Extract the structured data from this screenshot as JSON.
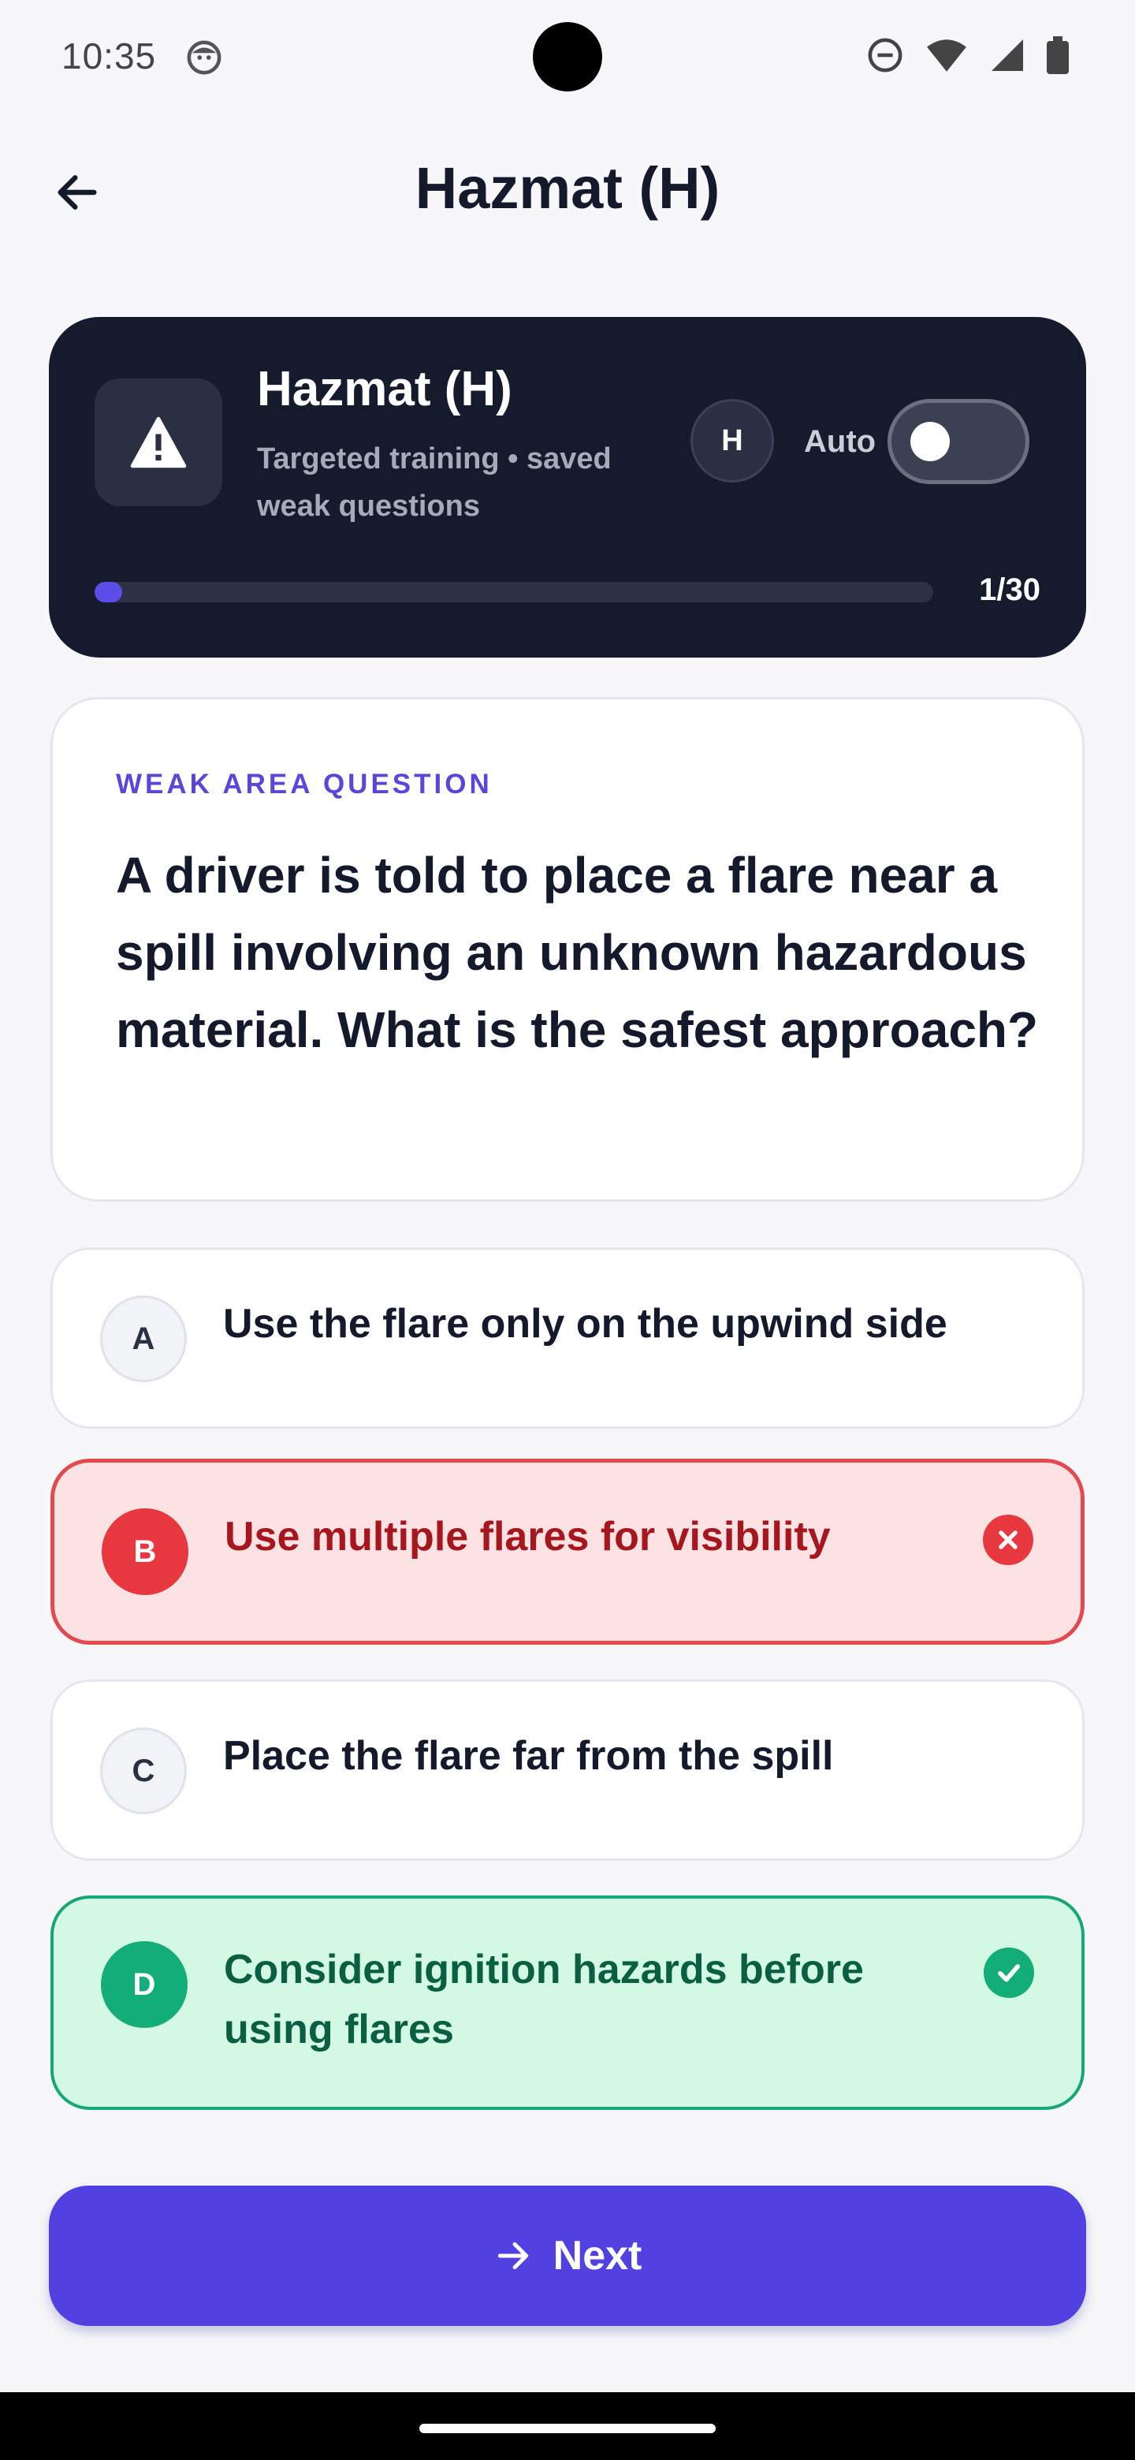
{
  "status_bar": {
    "time": "10:35"
  },
  "header": {
    "title": "Hazmat (H)"
  },
  "hero": {
    "title": "Hazmat (H)",
    "subtitle": "Targeted training • saved weak questions",
    "badge": "H",
    "auto_label": "Auto",
    "auto_enabled": false,
    "progress_text": "1/30",
    "progress_fraction": 0.033
  },
  "question": {
    "kicker": "WEAK AREA QUESTION",
    "text": "A driver is told to place a flare near a spill involving an unknown hazardous material. What is the safest approach?"
  },
  "options": [
    {
      "letter": "A",
      "text": "Use the flare only on the upwind side",
      "state": "neutral"
    },
    {
      "letter": "B",
      "text": "Use multiple flares for visibility",
      "state": "wrong"
    },
    {
      "letter": "C",
      "text": "Place the flare far from the spill",
      "state": "neutral"
    },
    {
      "letter": "D",
      "text": "Consider ignition hazards before using flares",
      "state": "correct"
    }
  ],
  "next_button": {
    "label": "Next"
  },
  "colors": {
    "accent": "#5041e0",
    "hero_bg": "#151a2c",
    "wrong": "#e8383f",
    "correct": "#12ad78"
  }
}
